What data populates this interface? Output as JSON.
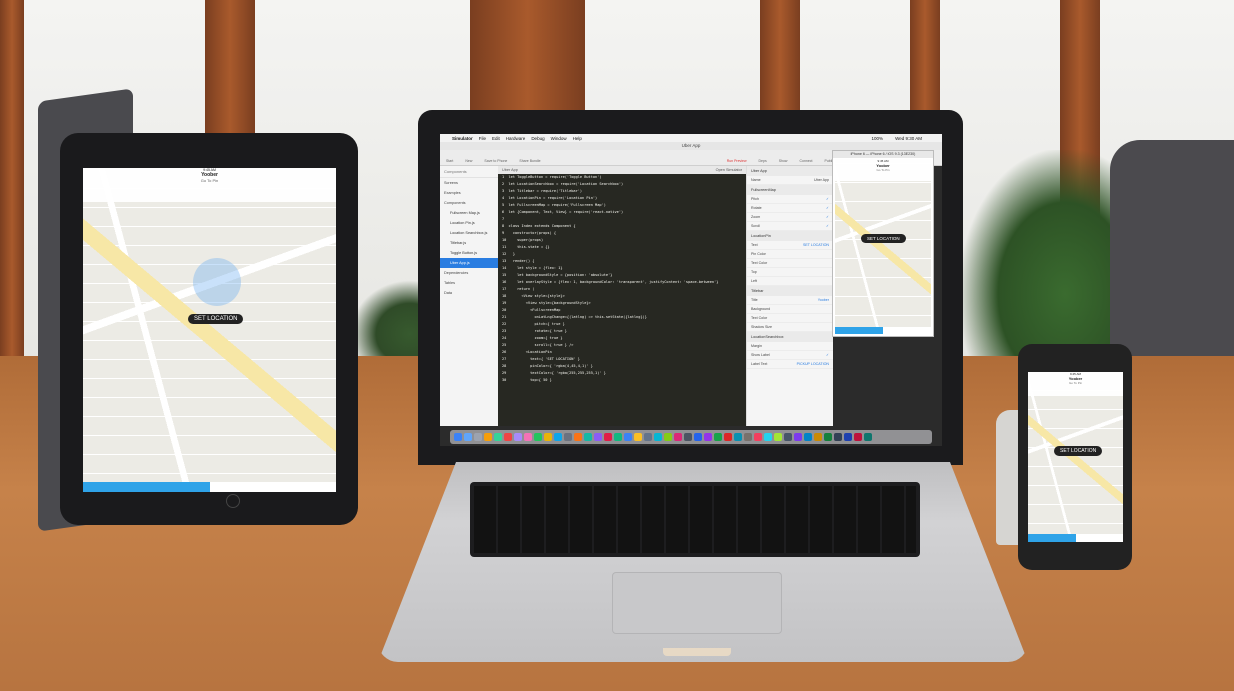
{
  "ipad": {
    "time": "9:45 AM",
    "nav_title": "Yoober",
    "subtitle_1": "",
    "subtitle_2": "Go To Pin",
    "set_location": "SET LOCATION",
    "primary_button": "",
    "secondary_button": ""
  },
  "mac": {
    "menubar": {
      "apple": "",
      "items": [
        "Simulator",
        "File",
        "Edit",
        "Hardware",
        "Debug",
        "Window",
        "Help"
      ],
      "status": "100%",
      "clock": "Wed 9:30 AM"
    },
    "window_title": "Uber App",
    "toolbar": {
      "left": [
        "Start",
        "New",
        "Save to Phone",
        "Share Bundle"
      ],
      "right": [
        "Run Preview",
        "Deps",
        "Show",
        "Connect",
        "Publish"
      ]
    },
    "sidebar": {
      "header": "Components",
      "items": [
        {
          "label": "Screens",
          "kind": "group"
        },
        {
          "label": "Examples",
          "kind": "group"
        },
        {
          "label": "Components",
          "kind": "group"
        },
        {
          "label": "Fullscreen Map.js",
          "kind": "file"
        },
        {
          "label": "Location Pin.js",
          "kind": "file"
        },
        {
          "label": "Location Searchbox.js",
          "kind": "file"
        },
        {
          "label": "Titlebar.js",
          "kind": "file"
        },
        {
          "label": "Toggle Button.js",
          "kind": "file"
        },
        {
          "label": "Uber App.js",
          "kind": "active"
        },
        {
          "label": "Dependencies",
          "kind": "group"
        },
        {
          "label": "Tables",
          "kind": "group"
        },
        {
          "label": "Data",
          "kind": "group"
        }
      ]
    },
    "editor": {
      "tab_left": "Uber App",
      "tab_right": "Open Simulator",
      "code": [
        "1  let ToggleButton = require('Toggle Button')",
        "2  let LocationSearchbox = require('Location Searchbox')",
        "3  let Titlebar = require('Titlebar')",
        "4  let LocationPin = require('Location Pin')",
        "5  let FullscreenMap = require('Fullscreen Map')",
        "6  let {Component, Text, View} = require('react-native')",
        "7",
        "8  class Index extends Component {",
        "9    constructor(props) {",
        "10     super(props)",
        "11     this.state = {}",
        "12   }",
        "13   render() {",
        "14     let style = {flex: 1}",
        "15     let backgroundStyle = {position: 'absolute'}",
        "16     let overlayStyle = {flex: 1, backgroundColor: 'transparent', justifyContent: 'space-between'}",
        "17     return (",
        "18       <View style={style}>",
        "19         <View style={backgroundStyle}>",
        "20           <FullscreenMap",
        "21             onLatLngChange={(latlng) => this.setState({latlng})}",
        "22             pitch={ true }",
        "23             rotate={ true }",
        "24             zoom={ true }",
        "25             scroll={ true } />",
        "26         <LocationPin",
        "27           text={ 'SET LOCATION' }",
        "28           pinColor={ 'rgba(4,45,4,1)' }",
        "29           textColor={ 'rgba(255,255,255,1)' }",
        "30           top={ 50 }"
      ]
    },
    "inspector": {
      "header": "Uber App",
      "name_label": "Name",
      "name_value": "Uber App",
      "section_1": "FullscreenMap",
      "rows_1": [
        {
          "label": "Pitch",
          "value": "✓"
        },
        {
          "label": "Rotate",
          "value": "✓"
        },
        {
          "label": "Zoom",
          "value": "✓"
        },
        {
          "label": "Scroll",
          "value": "✓"
        }
      ],
      "section_2": "LocationPin",
      "rows_2": [
        {
          "label": "Text",
          "value": "SET LOCATION"
        },
        {
          "label": "Pin Color",
          "value": ""
        },
        {
          "label": "Text Color",
          "value": ""
        },
        {
          "label": "Top",
          "value": ""
        },
        {
          "label": "Left",
          "value": ""
        }
      ],
      "section_3": "Titlebar",
      "rows_3": [
        {
          "label": "Title",
          "value": "Yoober"
        },
        {
          "label": "Background",
          "value": ""
        },
        {
          "label": "Text Color",
          "value": ""
        },
        {
          "label": "Shadow Size",
          "value": ""
        }
      ],
      "section_4": "LocationSearchbox",
      "rows_4": [
        {
          "label": "Margin",
          "value": ""
        },
        {
          "label": "Show Label",
          "value": "✓"
        },
        {
          "label": "Label Text",
          "value": "PICKUP LOCATION"
        }
      ]
    },
    "simulator": {
      "title": "iPhone 6 — iPhone 6 / iOS 9.3 (13E230)",
      "time": "9:45 AM",
      "nav_title": "Yoober",
      "subtitle": "Go To Pin",
      "set_location": "SET LOCATION"
    },
    "dock_colors": [
      "#3b82f6",
      "#60a5fa",
      "#9ca3af",
      "#f59e0b",
      "#34d399",
      "#ef4444",
      "#a78bfa",
      "#f472b6",
      "#22c55e",
      "#eab308",
      "#0ea5e9",
      "#6b7280",
      "#f97316",
      "#14b8a6",
      "#8b5cf6",
      "#e11d48",
      "#10b981",
      "#3b82f6",
      "#fbbf24",
      "#64748b",
      "#06b6d4",
      "#84cc16",
      "#db2777",
      "#4b5563",
      "#2563eb",
      "#9333ea",
      "#16a34a",
      "#dc2626",
      "#0891b2",
      "#78716c",
      "#f43f5e",
      "#22d3ee",
      "#a3e635",
      "#475569",
      "#7c3aed",
      "#0284c7",
      "#ca8a04",
      "#15803d",
      "#334155",
      "#1e40af",
      "#be123c",
      "#0f766e"
    ]
  },
  "iphone": {
    "time": "9:45 AM",
    "nav_title": "Yoober",
    "subtitle": "Go To Pin",
    "set_location": "SET LOCATION"
  }
}
